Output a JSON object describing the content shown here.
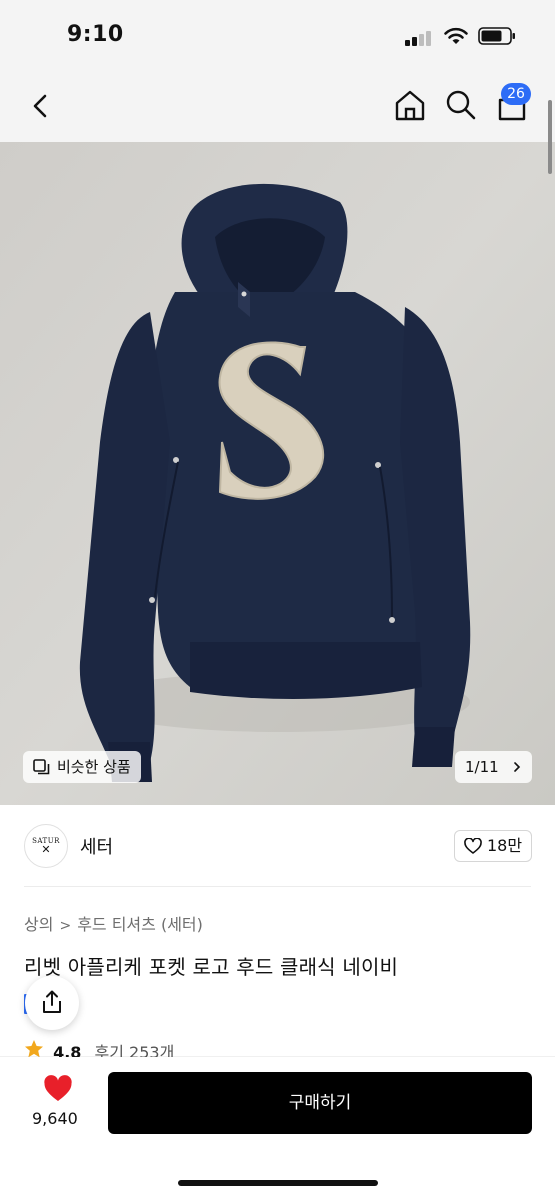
{
  "status_bar": {
    "time": "9:10"
  },
  "nav": {
    "cart_count": "26"
  },
  "gallery": {
    "similar_label": "비슷한 상품",
    "pager": "1/11"
  },
  "brand": {
    "logo_text": "SATUR",
    "name": "세터",
    "likes": "18만"
  },
  "breadcrumb": {
    "category": "상의",
    "subcategory": "후드 티셔츠 (세터)"
  },
  "product": {
    "title": "리벳 아플리케 포켓 로고 후드 클래식 네이비",
    "rating": "4.8",
    "reviews": "후기 253개"
  },
  "bottom_bar": {
    "favorite_count": "9,640",
    "buy_label": "구매하기"
  },
  "colors": {
    "accent": "#2d6cf6",
    "heart": "#e8202a",
    "hoodie": "#1e2a45",
    "patch": "#d9d0bd",
    "background": "#d4d3cf"
  },
  "icons": [
    "back-icon",
    "home-icon",
    "search-icon",
    "cart-icon",
    "similar-icon",
    "chevron-right-icon",
    "heart-outline-icon",
    "share-icon",
    "star-icon",
    "heart-filled-icon"
  ]
}
